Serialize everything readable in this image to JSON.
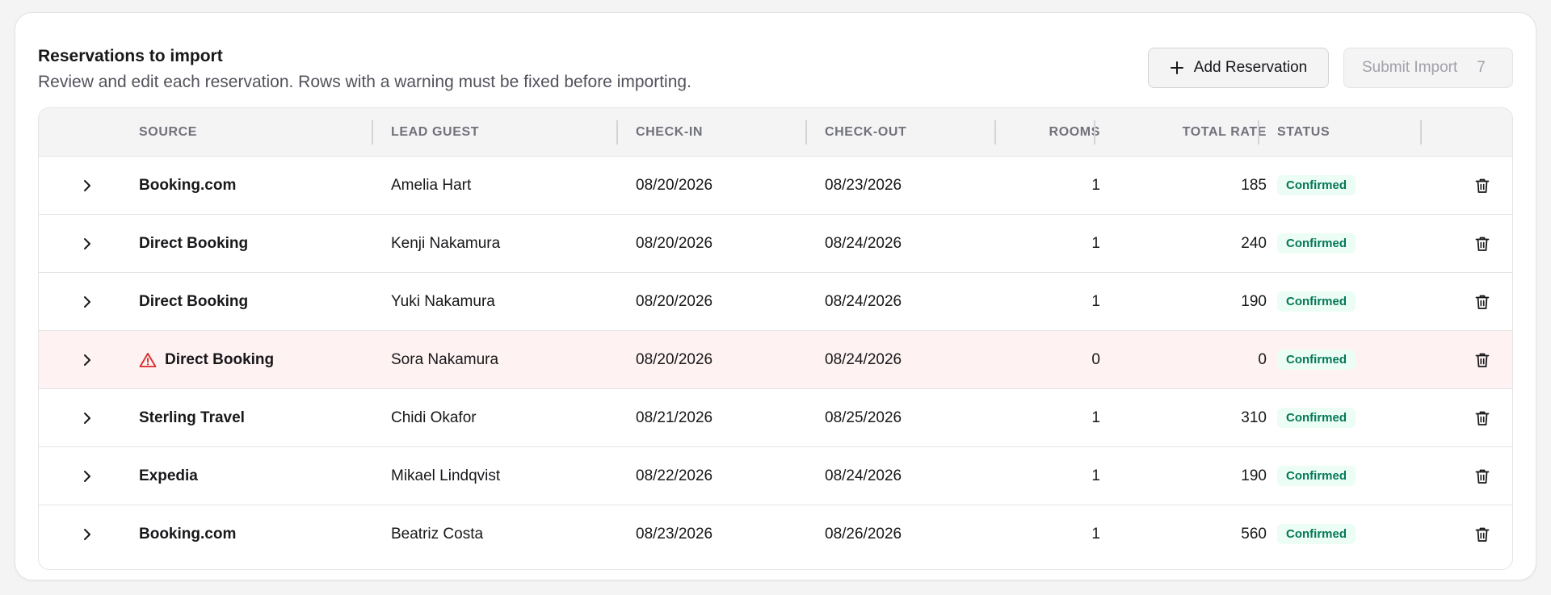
{
  "header": {
    "title": "Reservations to import",
    "subtitle": "Review and edit each reservation. Rows with a warning must be fixed before importing.",
    "add_label": "Add Reservation",
    "submit_label": "Submit Import",
    "submit_count": "7"
  },
  "columns": {
    "source": "SOURCE",
    "lead_guest": "LEAD GUEST",
    "check_in": "CHECK-IN",
    "check_out": "CHECK-OUT",
    "rooms": "ROOMS",
    "total_rate": "TOTAL RATE",
    "status": "STATUS"
  },
  "rows": [
    {
      "source": "Booking.com",
      "guest": "Amelia Hart",
      "check_in": "08/20/2026",
      "check_out": "08/23/2026",
      "rooms": "1",
      "rate": "185",
      "status": "Confirmed",
      "warning": false
    },
    {
      "source": "Direct Booking",
      "guest": "Kenji Nakamura",
      "check_in": "08/20/2026",
      "check_out": "08/24/2026",
      "rooms": "1",
      "rate": "240",
      "status": "Confirmed",
      "warning": false
    },
    {
      "source": "Direct Booking",
      "guest": "Yuki Nakamura",
      "check_in": "08/20/2026",
      "check_out": "08/24/2026",
      "rooms": "1",
      "rate": "190",
      "status": "Confirmed",
      "warning": false
    },
    {
      "source": "Direct Booking",
      "guest": "Sora Nakamura",
      "check_in": "08/20/2026",
      "check_out": "08/24/2026",
      "rooms": "0",
      "rate": "0",
      "status": "Confirmed",
      "warning": true
    },
    {
      "source": "Sterling Travel",
      "guest": "Chidi Okafor",
      "check_in": "08/21/2026",
      "check_out": "08/25/2026",
      "rooms": "1",
      "rate": "310",
      "status": "Confirmed",
      "warning": false
    },
    {
      "source": "Expedia",
      "guest": "Mikael Lindqvist",
      "check_in": "08/22/2026",
      "check_out": "08/24/2026",
      "rooms": "1",
      "rate": "190",
      "status": "Confirmed",
      "warning": false
    },
    {
      "source": "Booking.com",
      "guest": "Beatriz Costa",
      "check_in": "08/23/2026",
      "check_out": "08/26/2026",
      "rooms": "1",
      "rate": "560",
      "status": "Confirmed",
      "warning": false
    }
  ],
  "icons": {
    "expand": "chevron-right-icon",
    "delete": "trash-icon",
    "warning": "warning-triangle-icon",
    "add": "plus-icon"
  },
  "colors": {
    "status_text": "#047857",
    "status_bg": "#ecfdf5",
    "warning_row_bg": "#fef2f2",
    "warning_icon": "#dc2626"
  }
}
